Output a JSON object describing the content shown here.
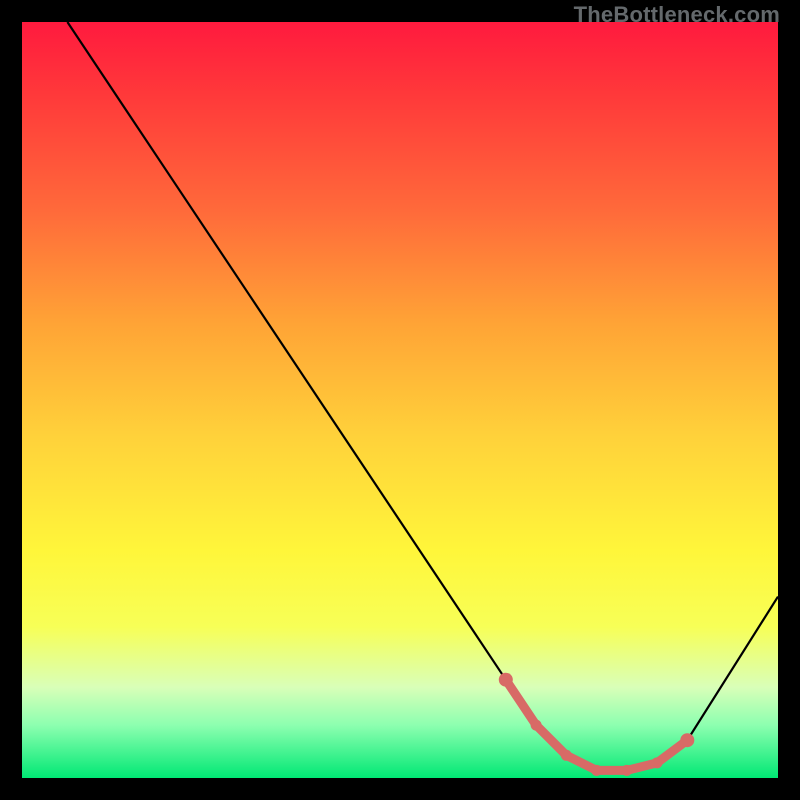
{
  "watermark": "TheBottleneck.com",
  "chart_data": {
    "type": "line",
    "title": "",
    "xlabel": "",
    "ylabel": "",
    "xlim": [
      0,
      100
    ],
    "ylim": [
      0,
      100
    ],
    "series": [
      {
        "name": "bottleneck-curve",
        "x": [
          6,
          10,
          20,
          30,
          40,
          50,
          60,
          64,
          68,
          72,
          76,
          80,
          84,
          88,
          100
        ],
        "y": [
          100,
          94,
          79,
          64,
          49,
          34,
          19,
          13,
          7,
          3,
          1,
          1,
          2,
          5,
          24
        ],
        "color": "#000000"
      }
    ],
    "highlight": {
      "name": "optimal-range",
      "x": [
        64,
        68,
        72,
        76,
        80,
        84,
        88
      ],
      "y": [
        13,
        7,
        3,
        1,
        1,
        2,
        5
      ],
      "color": "#d86a66"
    },
    "background": {
      "type": "vertical-gradient",
      "stops": [
        {
          "pos": 0,
          "color": "#ff1a3e"
        },
        {
          "pos": 50,
          "color": "#ffd23a"
        },
        {
          "pos": 80,
          "color": "#fff63a"
        },
        {
          "pos": 100,
          "color": "#00e874"
        }
      ]
    }
  }
}
